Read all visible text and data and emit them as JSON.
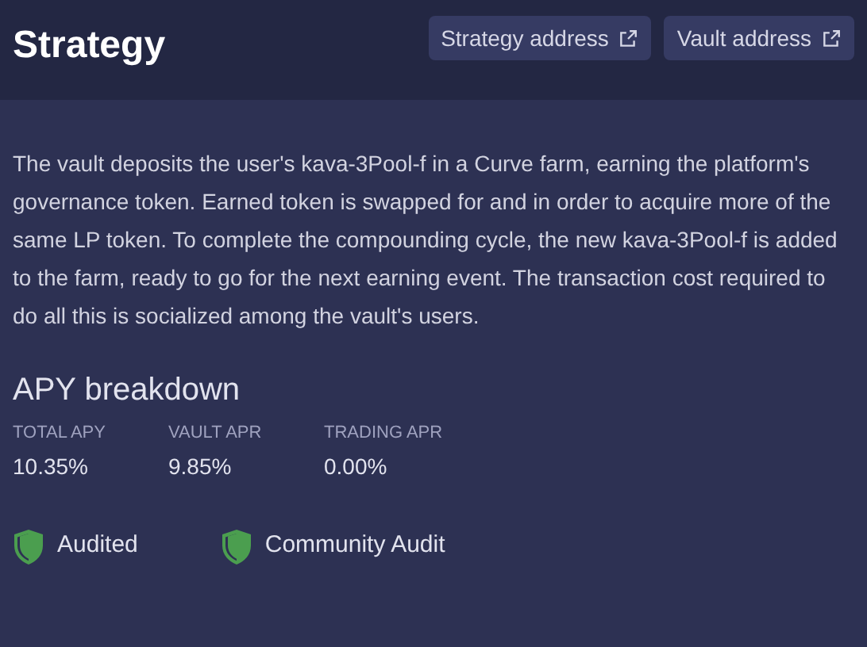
{
  "title": "Strategy",
  "links": [
    "Strategy address",
    "Vault address"
  ],
  "description": "The vault deposits the user's kava-3Pool-f in a Curve farm, earning the platform's governance token. Earned token is swapped for and in order to acquire more of the same LP token. To complete the compounding cycle, the new kava-3Pool-f is added to the farm, ready to go for the next earning event. The transaction cost required to do all this is socialized among the vault's users.",
  "apy": {
    "heading": "APY breakdown",
    "stats": [
      {
        "label": "TOTAL APY",
        "value": "10.35%"
      },
      {
        "label": "VAULT APR",
        "value": "9.85%"
      },
      {
        "label": "TRADING APR",
        "value": "0.00%"
      }
    ]
  },
  "audits": [
    "Audited",
    "Community Audit"
  ]
}
